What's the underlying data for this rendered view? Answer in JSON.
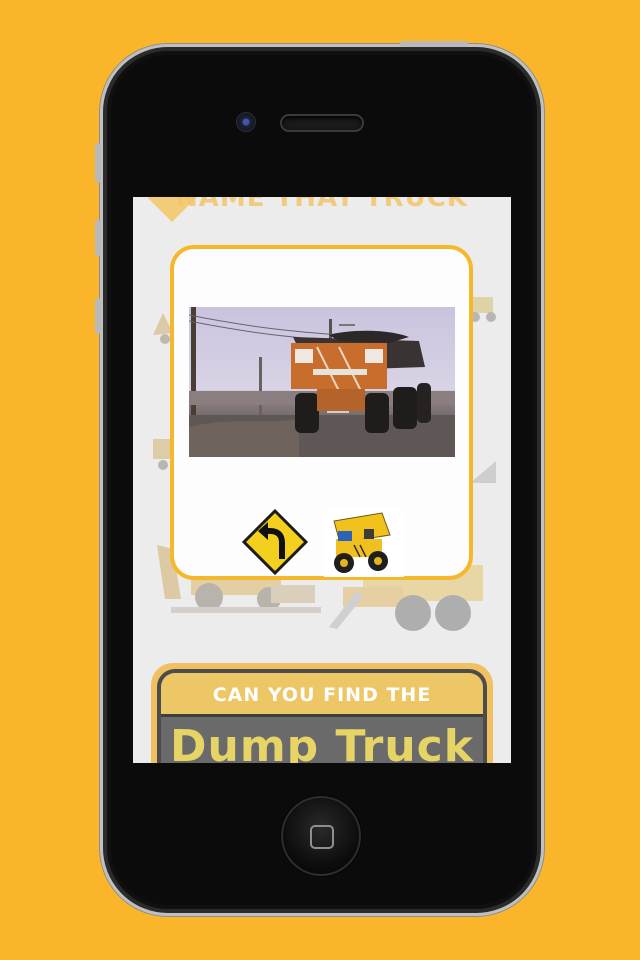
{
  "app": {
    "title": "NAME THAT TRUCK"
  },
  "banner": {
    "prompt": "CAN YOU FIND THE",
    "target": "Dump Truck"
  },
  "modal": {
    "video_icon": "dump-truck-video",
    "answers": [
      {
        "icon": "curve-left-road-sign-icon"
      },
      {
        "icon": "dump-truck-icon"
      }
    ]
  },
  "colors": {
    "background": "#fbb52a",
    "accent": "#f5b82a",
    "banner_text": "#e7d466"
  }
}
